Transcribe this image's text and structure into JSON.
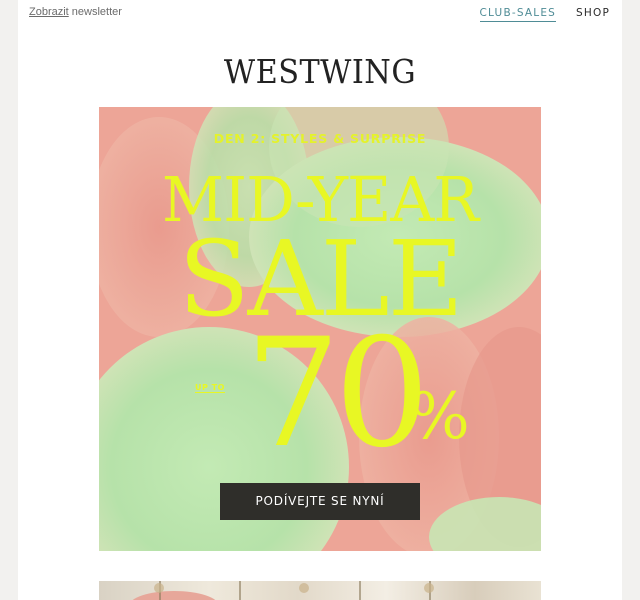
{
  "header": {
    "view_link": "Zobrazit",
    "view_suffix": " newsletter",
    "nav": [
      {
        "label": "CLUB-SALES",
        "active": true
      },
      {
        "label": "SHOP",
        "active": false
      }
    ]
  },
  "logo": "WESTWING",
  "banner": {
    "kicker": "DEN 2: STYLES & SURPRISE",
    "headline_top": "MID-YEAR",
    "headline_main": "SALE",
    "upto": "UP TO",
    "discount_number": "70",
    "discount_sign": "%",
    "cta_label": "PODÍVEJTE SE NYNÍ"
  },
  "colors": {
    "accent_teal": "#4f8c96",
    "sale_yellow": "#e8f724",
    "banner_pink": "#eda597",
    "banner_mint": "#b8e3ad",
    "button_dark": "#2f2e2a"
  }
}
